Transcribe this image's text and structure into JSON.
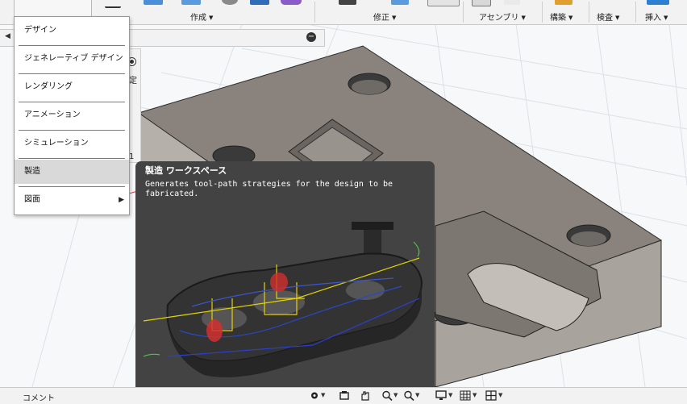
{
  "ribbon": {
    "groups": [
      {
        "label": "作成",
        "icon": "create-icon"
      },
      {
        "label": "修正",
        "icon": "modify-icon"
      },
      {
        "label": "アセンブリ",
        "icon": "assemble-icon"
      },
      {
        "label": "構築",
        "icon": "construct-icon"
      },
      {
        "label": "検査",
        "icon": "inspect-icon"
      },
      {
        "label": "挿入",
        "icon": "insert-icon"
      }
    ],
    "accent": "#1a73c9"
  },
  "workspace_menu": {
    "items": [
      {
        "label": "デザイン"
      },
      {
        "label": "ジェネレーティブ デザイン"
      },
      {
        "label": "レンダリング"
      },
      {
        "label": "アニメーション"
      },
      {
        "label": "シミュレーション"
      },
      {
        "label": "製造"
      },
      {
        "label": "図面"
      }
    ],
    "active_index": 5,
    "submenu_icon": "submenu-arrow-icon"
  },
  "browser": {
    "partial_label": "定",
    "partial_number": "1"
  },
  "tooltip": {
    "title": "製造 ワークスペース",
    "description": "Generates tool-path strategies for the design to be fabricated."
  },
  "bottombar": {
    "comment_label": "コメント",
    "icons": [
      "orbit-icon",
      "look-at-icon",
      "pan-icon",
      "zoom-icon",
      "fit-icon",
      "display-settings-icon",
      "grid-icon",
      "viewports-icon"
    ]
  }
}
